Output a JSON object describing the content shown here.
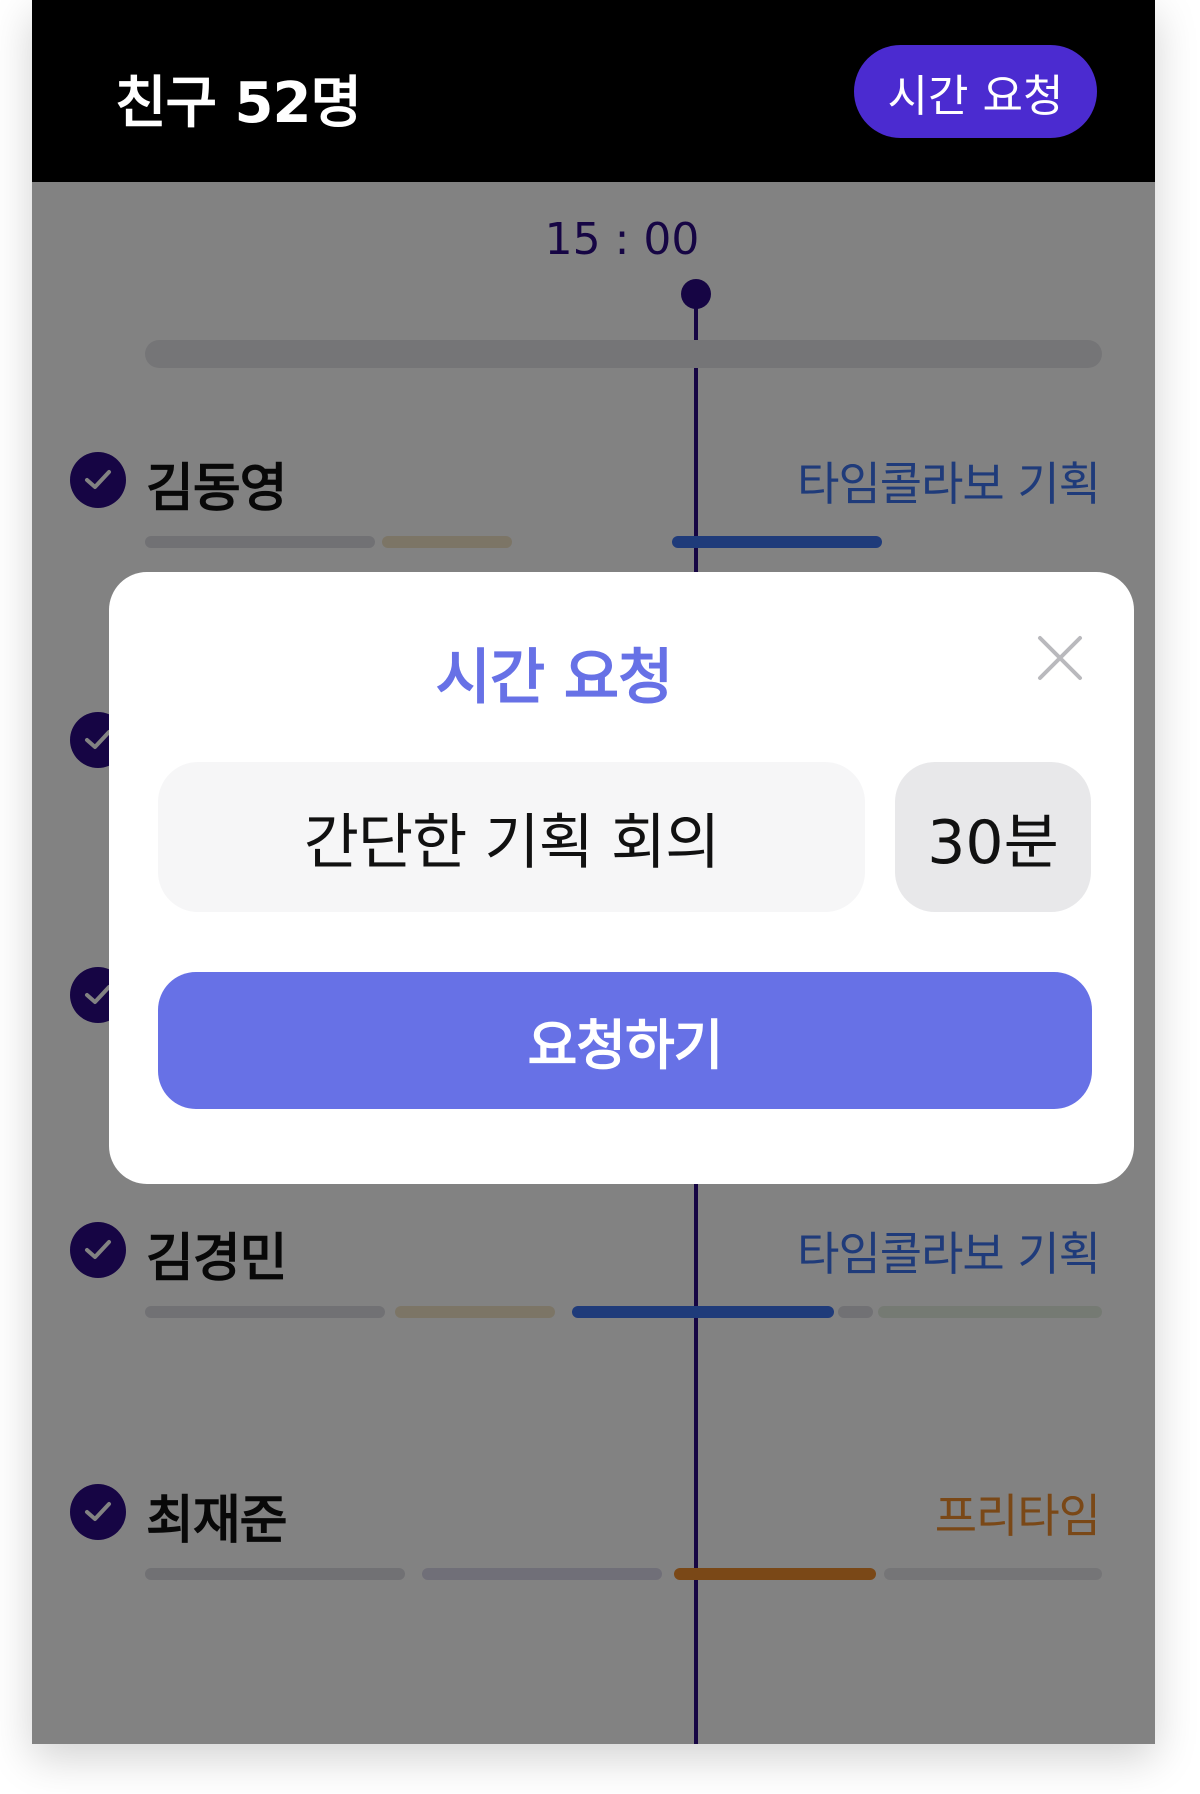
{
  "header": {
    "title": "친구 52명",
    "request_button": "시간 요청"
  },
  "timeline": {
    "current_time": "15 : 00"
  },
  "colors": {
    "accent": "#2b0b86",
    "brand_purple": "#4b2bd0",
    "modal_accent": "#6771e6",
    "status_meeting": "#3e74f0",
    "status_free": "#f08d2d"
  },
  "friends": [
    {
      "name": "김동영",
      "status": "타임콜라보 기획",
      "status_type": "meeting",
      "checked": true
    },
    {
      "name": "김경민",
      "status": "타임콜라보 기획",
      "status_type": "meeting",
      "checked": true
    },
    {
      "name": "최재준",
      "status": "프리타임",
      "status_type": "free",
      "checked": true
    }
  ],
  "modal": {
    "title": "시간 요청",
    "close_icon": "close-icon",
    "meeting_title_value": "간단한 기획 회의",
    "duration_value": "30분",
    "submit_label": "요청하기"
  }
}
